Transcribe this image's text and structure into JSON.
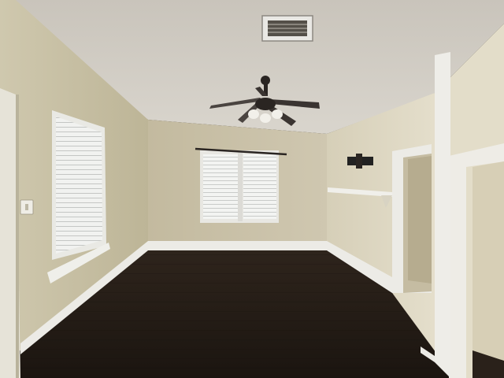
{
  "scene": {
    "subject": "empty-room-interior",
    "palette": {
      "ceiling": "#d2cdc4",
      "back_wall": "#c9c1aa",
      "left_wall": "#c2bb9f",
      "right_wall": "#d8d1bb",
      "floor_dark": "#1e1812",
      "floor_mid": "#2f261e",
      "trim_white": "#ecebe6",
      "window_glass": "#f4f5f4",
      "fan_dark": "#2a2522"
    },
    "icons": [
      "ceiling-fan-icon",
      "air-vent-icon",
      "light-switch-icon",
      "wall-mount-icon"
    ]
  }
}
